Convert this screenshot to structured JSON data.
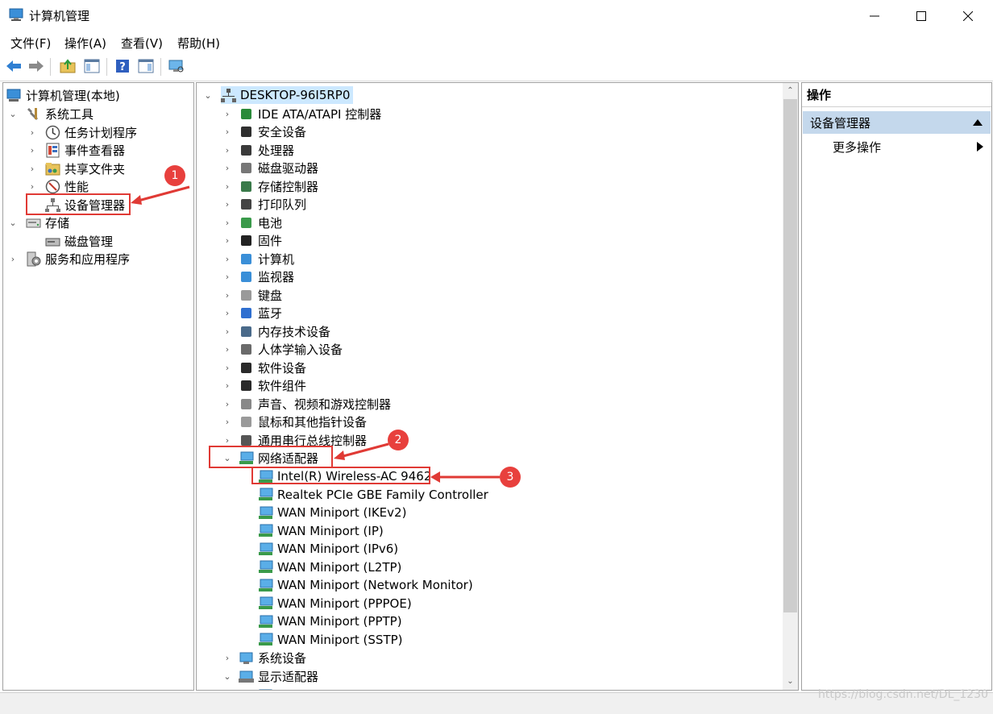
{
  "window": {
    "title": "计算机管理"
  },
  "menu": [
    "文件(F)",
    "操作(A)",
    "查看(V)",
    "帮助(H)"
  ],
  "left_tree": {
    "root": "计算机管理(本地)",
    "system_tools": "系统工具",
    "task_scheduler": "任务计划程序",
    "event_viewer": "事件查看器",
    "shared_folders": "共享文件夹",
    "performance": "性能",
    "device_manager": "设备管理器",
    "storage": "存储",
    "disk_management": "磁盘管理",
    "services_apps": "服务和应用程序"
  },
  "device_tree": {
    "root": "DESKTOP-96I5RP0",
    "categories": [
      "IDE ATA/ATAPI 控制器",
      "安全设备",
      "处理器",
      "磁盘驱动器",
      "存储控制器",
      "打印队列",
      "电池",
      "固件",
      "计算机",
      "监视器",
      "键盘",
      "蓝牙",
      "内存技术设备",
      "人体学输入设备",
      "软件设备",
      "软件组件",
      "声音、视频和游戏控制器",
      "鼠标和其他指针设备",
      "通用串行总线控制器"
    ],
    "network_adapters": "网络适配器",
    "network_children": [
      "Intel(R) Wireless-AC 9462",
      "Realtek PCIe GBE Family Controller",
      "WAN Miniport (IKEv2)",
      "WAN Miniport (IP)",
      "WAN Miniport (IPv6)",
      "WAN Miniport (L2TP)",
      "WAN Miniport (Network Monitor)",
      "WAN Miniport (PPPOE)",
      "WAN Miniport (PPTP)",
      "WAN Miniport (SSTP)"
    ],
    "system_devices": "系统设备",
    "display_adapters": "显示适配器"
  },
  "actions": {
    "header": "操作",
    "group": "设备管理器",
    "more": "更多操作"
  },
  "annotations": [
    "1",
    "2",
    "3"
  ],
  "watermark": "https://blog.csdn.net/DL_1230",
  "colors": {
    "highlight": "#e03a35",
    "selection": "#cce8ff",
    "action_group": "#c4d8ec"
  }
}
